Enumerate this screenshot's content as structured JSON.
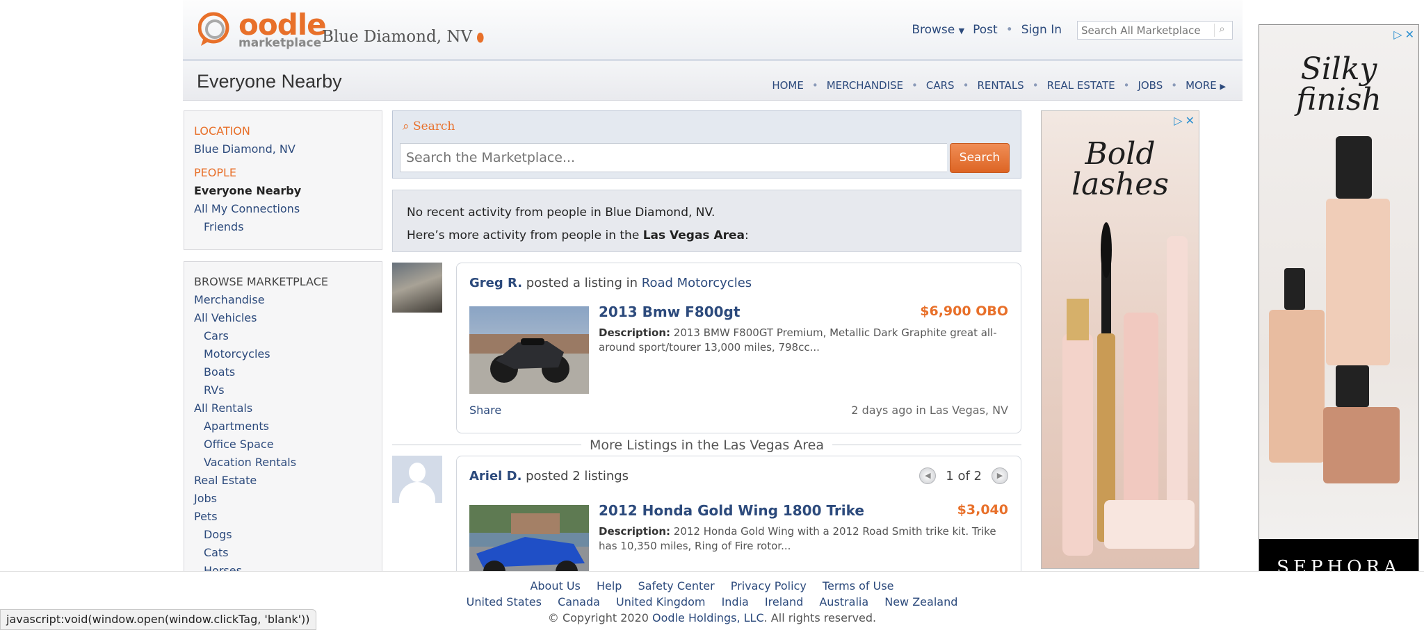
{
  "header": {
    "logo_text": "oodle",
    "logo_sub": "marketplace",
    "city": "Blue Diamond, NV",
    "nav": {
      "browse": "Browse",
      "post": "Post",
      "sign_in": "Sign In"
    },
    "search_placeholder": "Search All Marketplace"
  },
  "subbar": {
    "title": "Everyone Nearby",
    "categories": [
      "HOME",
      "MERCHANDISE",
      "CARS",
      "RENTALS",
      "REAL ESTATE",
      "JOBS",
      "MORE"
    ]
  },
  "sidebar": {
    "location_heading": "LOCATION",
    "location_value": "Blue Diamond, NV",
    "people_heading": "PEOPLE",
    "people_current": "Everyone Nearby",
    "people_all": "All My Connections",
    "people_friends": "Friends",
    "browse_heading": "BROWSE MARKETPLACE",
    "browse": [
      "Merchandise",
      "All Vehicles",
      "Cars",
      "Motorcycles",
      "Boats",
      "RVs",
      "All Rentals",
      "Apartments",
      "Office Space",
      "Vacation Rentals",
      "Real Estate",
      "Jobs",
      "Pets",
      "Dogs",
      "Cats",
      "Horses"
    ]
  },
  "search": {
    "label": "Search",
    "placeholder": "Search the Marketplace...",
    "button": "Search"
  },
  "notice": {
    "line1": "No recent activity from people in Blue Diamond, NV.",
    "line2_prefix": "Here’s more activity from people in the ",
    "line2_area": "Las Vegas Area",
    "line2_suffix": ":"
  },
  "feed": {
    "post1": {
      "user": "Greg R.",
      "action": " posted a listing in ",
      "category": "Road Motorcycles",
      "title": "2013 Bmw F800gt",
      "price": "$6,900 OBO",
      "desc_label": "Description:",
      "desc": " 2013 BMW F800GT Premium, Metallic Dark Graphite great all-around sport/tourer 13,000 miles, 798cc...",
      "share": "Share",
      "ago": "2 days ago in Las Vegas, NV"
    },
    "divider": "More Listings in the Las Vegas Area",
    "post2": {
      "user": "Ariel D.",
      "action": " posted 2 listings",
      "pager": "1 of 2",
      "title": "2012 Honda Gold Wing 1800 Trike",
      "price": "$3,040",
      "desc_label": "Description:",
      "desc": " 2012 Honda Gold Wing with a 2012 Road Smith trike kit. Trike has 10,350 miles, Ring of Fire rotor..."
    }
  },
  "ads": {
    "ad1_title_1": "Bold",
    "ad1_title_2": "lashes",
    "ad2_title_1": "Silky",
    "ad2_title_2": "finish",
    "ad2_brand": "SEPHORA"
  },
  "footer": {
    "links": [
      "About Us",
      "Help",
      "Safety Center",
      "Privacy Policy",
      "Terms of Use"
    ],
    "countries": [
      "United States",
      "Canada",
      "United Kingdom",
      "India",
      "Ireland",
      "Australia",
      "New Zealand"
    ],
    "copy_prefix": "© Copyright 2020 ",
    "copy_company": "Oodle Holdings, LLC",
    "copy_suffix": ". All rights reserved."
  },
  "statusbar": "javascript:void(window.open(window.clickTag, 'blank'))"
}
